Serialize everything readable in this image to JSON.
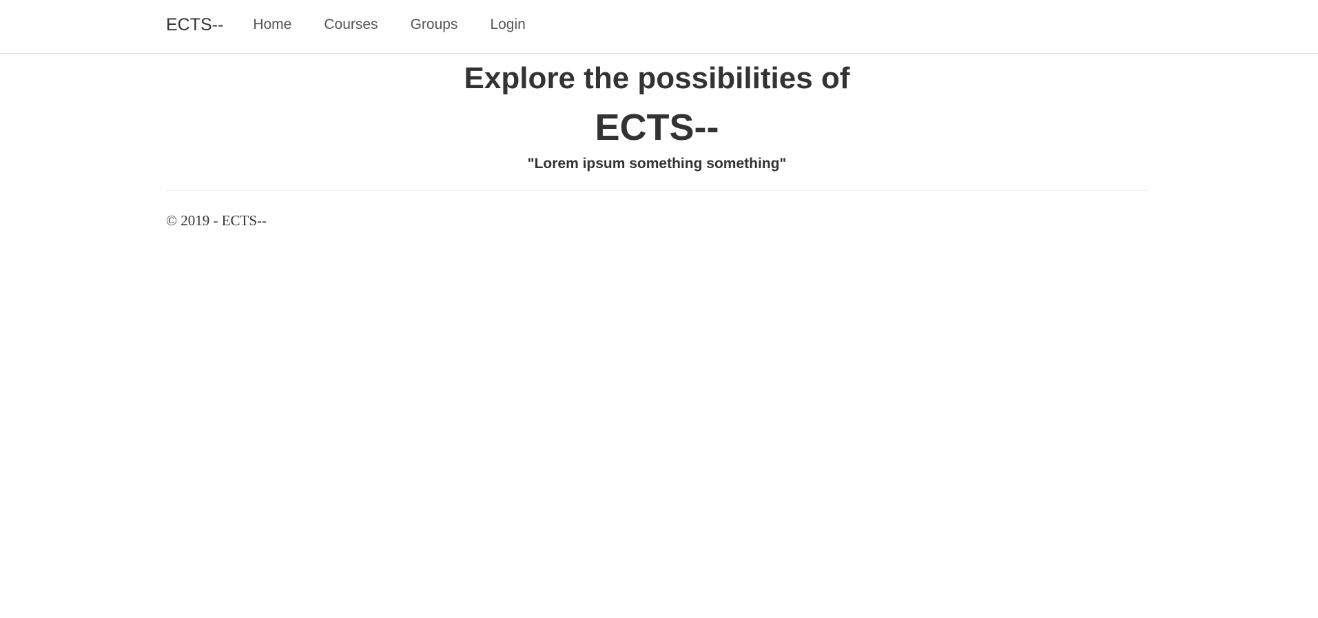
{
  "navbar": {
    "brand": "ECTS--",
    "links": [
      {
        "label": "Home"
      },
      {
        "label": "Courses"
      },
      {
        "label": "Groups"
      },
      {
        "label": "Login"
      }
    ]
  },
  "hero": {
    "title": "Explore the possibilities of",
    "brand": "ECTS--",
    "quote": "\"Lorem ipsum something something\""
  },
  "footer": {
    "text": "© 2019 - ECTS--"
  },
  "colors": {
    "text": "#333333",
    "nav_link": "#555555",
    "border": "#dcdcdc",
    "background": "#ffffff"
  }
}
